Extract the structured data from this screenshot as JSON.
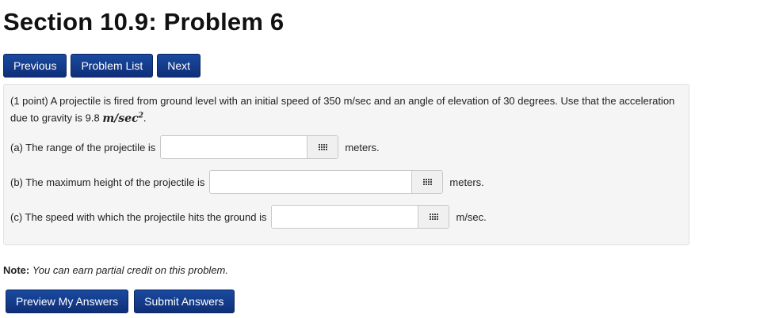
{
  "page_title": "Section 10.9: Problem 6",
  "nav": {
    "previous": "Previous",
    "problem_list": "Problem List",
    "next": "Next"
  },
  "problem": {
    "intro": "(1 point) A projectile is fired from ground level with an initial speed of 350 m/sec and an angle of elevation of 30 degrees. Use that the acceleration due to gravity is 9.8",
    "gravity_unit": "m/sec",
    "gravity_unit_exp": "2",
    "period": ".",
    "questions": [
      {
        "label": "(a) The range of the projectile is",
        "unit": "meters.",
        "value": ""
      },
      {
        "label": "(b) The maximum height of the projectile is",
        "unit": "meters.",
        "value": ""
      },
      {
        "label": "(c) The speed with which the projectile hits the ground is",
        "unit": "m/sec.",
        "value": ""
      }
    ],
    "answer_icon": "keyboard-grid-icon"
  },
  "note": {
    "label": "Note:",
    "text": "You can earn partial credit on this problem."
  },
  "actions": {
    "preview": "Preview My Answers",
    "submit": "Submit Answers"
  }
}
